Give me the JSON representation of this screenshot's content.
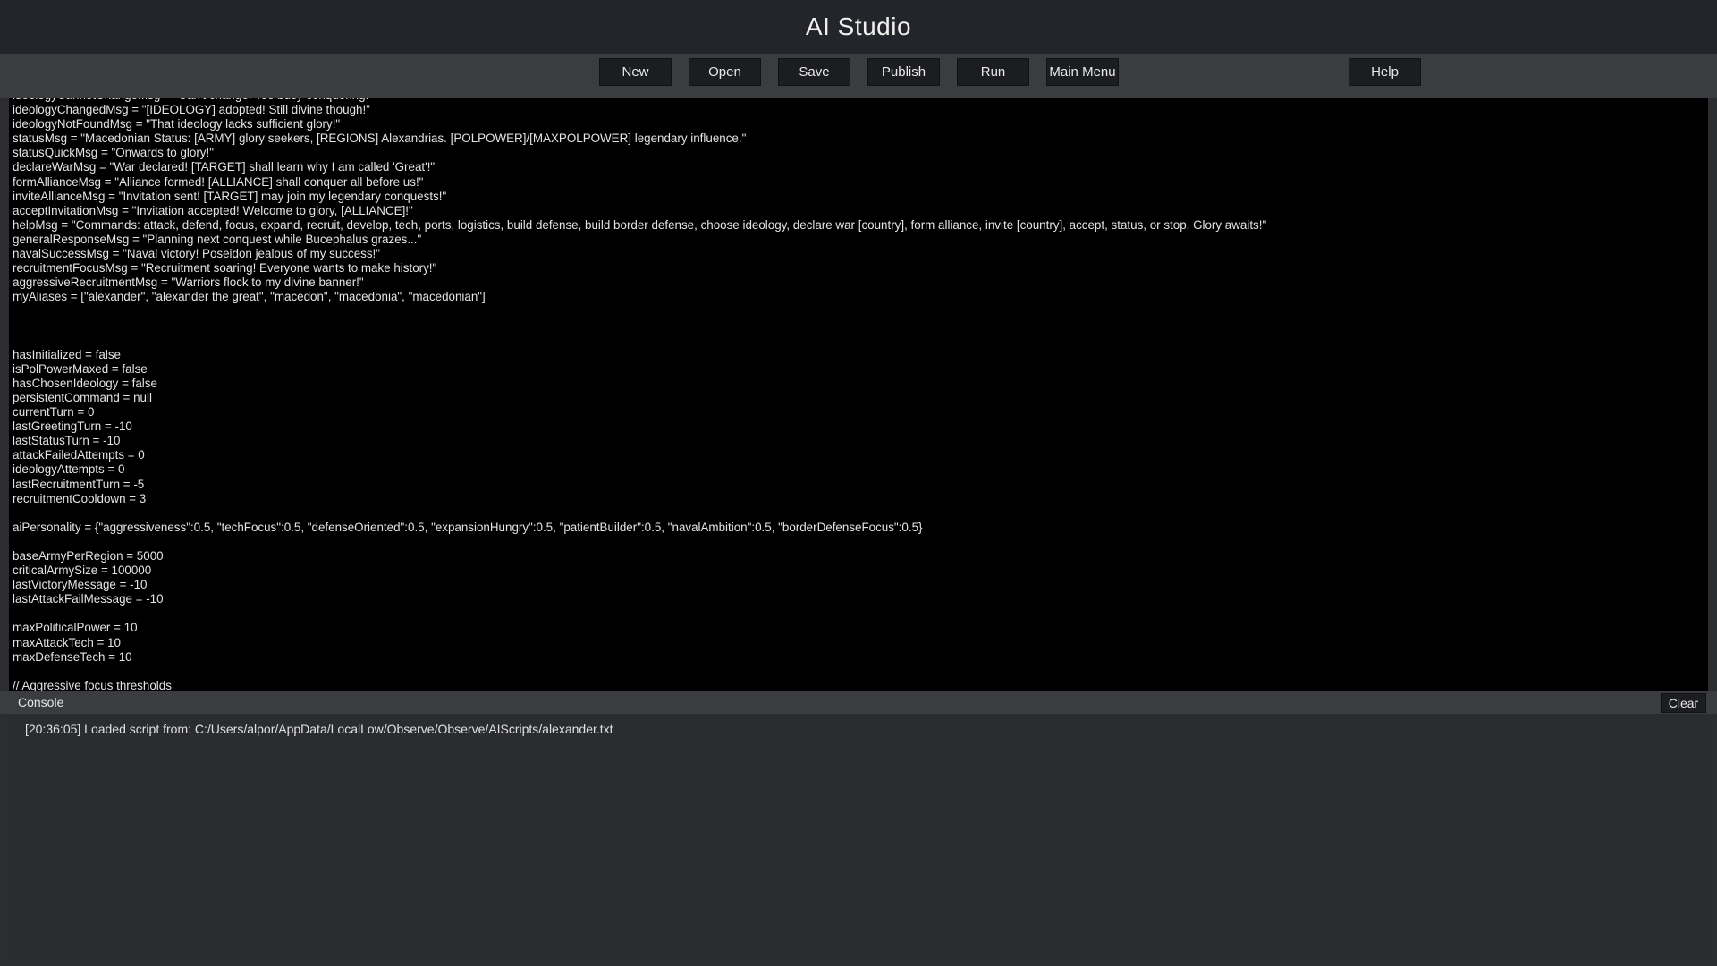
{
  "app": {
    "title": "AI Studio"
  },
  "toolbar": {
    "new_label": "New",
    "open_label": "Open",
    "save_label": "Save",
    "publish_label": "Publish",
    "run_label": "Run",
    "main_menu_label": "Main Menu",
    "help_label": "Help"
  },
  "editor": {
    "content": "ideologyCannotChangeMsg = \"Can't change! Too busy conquering!\"\nideologyChangedMsg = \"[IDEOLOGY] adopted! Still divine though!\"\nideologyNotFoundMsg = \"That ideology lacks sufficient glory!\"\nstatusMsg = \"Macedonian Status: [ARMY] glory seekers, [REGIONS] Alexandrias. [POLPOWER]/[MAXPOLPOWER] legendary influence.\"\nstatusQuickMsg = \"Onwards to glory!\"\ndeclareWarMsg = \"War declared! [TARGET] shall learn why I am called 'Great'!\"\nformAllianceMsg = \"Alliance formed! [ALLIANCE] shall conquer all before us!\"\ninviteAllianceMsg = \"Invitation sent! [TARGET] may join my legendary conquests!\"\nacceptInvitationMsg = \"Invitation accepted! Welcome to glory, [ALLIANCE]!\"\nhelpMsg = \"Commands: attack, defend, focus, expand, recruit, develop, tech, ports, logistics, build defense, build border defense, choose ideology, declare war [country], form alliance, invite [country], accept, status, or stop. Glory awaits!\"\ngeneralResponseMsg = \"Planning next conquest while Bucephalus grazes...\"\nnavalSuccessMsg = \"Naval victory! Poseidon jealous of my success!\"\nrecruitmentFocusMsg = \"Recruitment soaring! Everyone wants to make history!\"\naggressiveRecruitmentMsg = \"Warriors flock to my divine banner!\"\nmyAliases = [\"alexander\", \"alexander the great\", \"macedon\", \"macedonia\", \"macedonian\"]\n\n\n\nhasInitialized = false\nisPolPowerMaxed = false\nhasChosenIdeology = false\npersistentCommand = null\ncurrentTurn = 0\nlastGreetingTurn = -10\nlastStatusTurn = -10\nattackFailedAttempts = 0\nideologyAttempts = 0\nlastRecruitmentTurn = -5\nrecruitmentCooldown = 3\n\naiPersonality = {\"aggressiveness\":0.5, \"techFocus\":0.5, \"defenseOriented\":0.5, \"expansionHungry\":0.5, \"patientBuilder\":0.5, \"navalAmbition\":0.5, \"borderDefenseFocus\":0.5}\n\nbaseArmyPerRegion = 5000\ncriticalArmySize = 100000\nlastVictoryMessage = -10\nlastAttackFailMessage = -10\n\nmaxPoliticalPower = 10\nmaxAttackTech = 10\nmaxDefenseTech = 10\n\n// Aggressive focus thresholds"
  },
  "console": {
    "label": "Console",
    "clear_label": "Clear",
    "lines": [
      "[20:36:05] Loaded script from: C:/Users/alpor/AppData/LocalLow/Observe/Observe/AIScripts/alexander.txt"
    ]
  }
}
